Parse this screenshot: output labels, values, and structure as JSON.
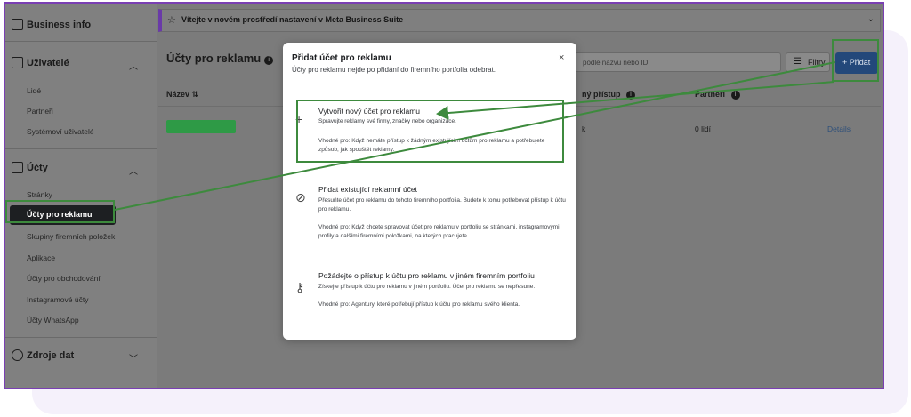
{
  "sidebar": {
    "business_info": "Business info",
    "users_section": {
      "label": "Uživatelé",
      "items": [
        "Lidé",
        "Partneři",
        "Systémoví uživatelé"
      ]
    },
    "accounts_section": {
      "label": "Účty",
      "items": [
        "Stránky",
        "Účty pro reklamu",
        "Skupiny firemních položek",
        "Aplikace",
        "Účty pro obchodování",
        "Instagramové účty",
        "Účty WhatsApp"
      ],
      "active_index": 1
    },
    "data_sources": "Zdroje dat"
  },
  "banner": {
    "text": "Vítejte v novém prostředí nastavení v Meta Business Suite"
  },
  "page": {
    "title": "Účty pro reklamu",
    "search_placeholder": "podle názvu nebo ID",
    "filter_label": "Filtry",
    "add_label": "+ Přidat",
    "columns": {
      "name": "Název ⇅",
      "access": "ný přístup",
      "partners": "Partneři"
    },
    "row": {
      "access": "k",
      "partners": "0 lidí",
      "details": "Details"
    }
  },
  "modal": {
    "title": "Přidat účet pro reklamu",
    "subtitle": "Účty pro reklamu nejde po přidání do firemního portfolia odebrat.",
    "close": "×",
    "options": [
      {
        "icon": "plus-icon",
        "title": "Vytvořit nový účet pro reklamu",
        "desc": "Spravujte reklamy své firmy, značky nebo organizace.",
        "note": "Vhodné pro: Když nemáte přístup k žádným existujícím účtům pro reklamu a potřebujete způsob, jak spouštět reklamy."
      },
      {
        "icon": "tag-icon",
        "title": "Přidat existující reklamní účet",
        "desc": "Přesuňte účet pro reklamu do tohoto firemního portfolia. Budete k tomu potřebovat přístup k účtu pro reklamu.",
        "note": "Vhodné pro: Když chcete spravovat účet pro reklamu v portfoliu se stránkami, instagramovými profily a dalšími firemními položkami, na kterých pracujete."
      },
      {
        "icon": "key-icon",
        "title": "Požádejte o přístup k účtu pro reklamu v jiném firemním portfoliu",
        "desc": "Získejte přístup k účtu pro reklamu v jiném portfoliu. Účet pro reklamu se nepřesune.",
        "note": "Vhodné pro: Agentury, které potřebují přístup k účtu pro reklamu svého klienta."
      }
    ]
  },
  "colors": {
    "highlight": "#3d8a3d",
    "frame": "#7a3fb3",
    "primary_button": "#23487a"
  }
}
